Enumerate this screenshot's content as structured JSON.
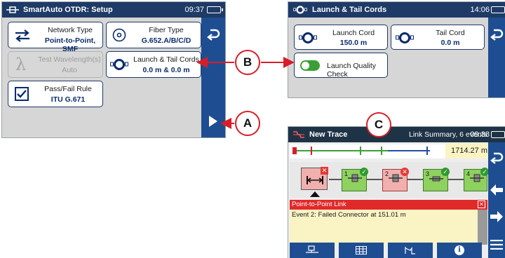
{
  "panel_a": {
    "title": "SmartAuto OTDR: Setup",
    "time": "09:37",
    "buttons": {
      "network_type": {
        "label": "Network Type",
        "value": "Point-to-Point, SMF"
      },
      "fiber_type": {
        "label": "Fiber Type",
        "value": "G.652.A/B/C/D"
      },
      "test_wavelength": {
        "label": "Test Wavelength(s)",
        "value": "Auto"
      },
      "launch_tail": {
        "label": "Launch & Tail Cords",
        "value": "0.0 m & 0.0 m"
      },
      "pass_fail": {
        "label": "Pass/Fail Rule",
        "value": "ITU G.671"
      }
    }
  },
  "panel_b": {
    "title": "Launch & Tail Cords",
    "time": "14:06",
    "launch_cord": {
      "label": "Launch Cord",
      "value": "150.0 m"
    },
    "tail_cord": {
      "label": "Tail Cord",
      "value": "0.0 m"
    },
    "quality_check": {
      "label": "Launch Quality Check",
      "state": "on"
    }
  },
  "panel_c": {
    "title": "New Trace",
    "summary": "Link Summary, 6 events",
    "time": "09:38",
    "distance": "1714.27 m",
    "events": [
      "1",
      "2",
      "3",
      "4"
    ],
    "banner": "Point-to-Point Link",
    "message": "Event 2: Failed Connector at 151.01 m"
  },
  "callouts": {
    "a": "A",
    "b": "B",
    "c": "C"
  },
  "colors": {
    "titlebar": "#1e3a66",
    "sidebar": "#1e4e91",
    "callout": "#d71e28",
    "pass": "#5cbf3a",
    "fail": "#e53935"
  }
}
